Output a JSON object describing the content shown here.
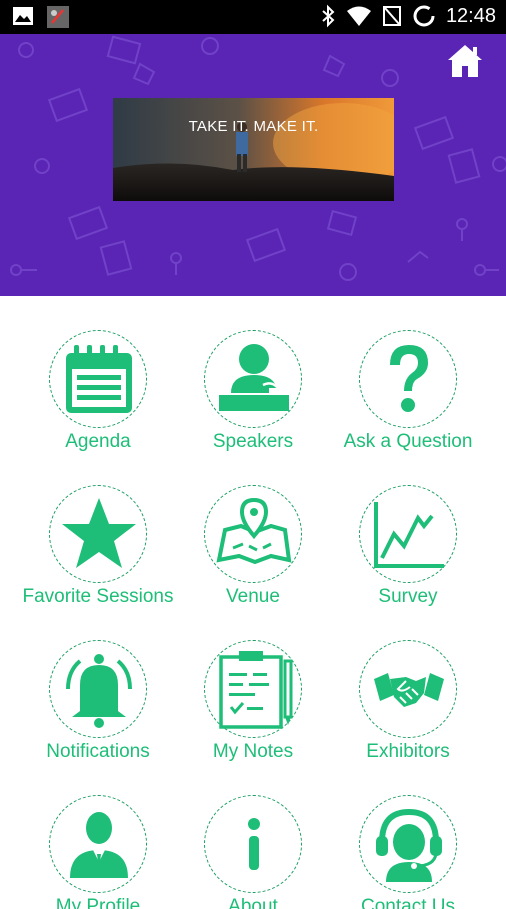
{
  "status_bar": {
    "time": "12:48",
    "left_icons": [
      "image-icon",
      "app-notification-icon"
    ],
    "right_icons": [
      "bluetooth-icon",
      "wifi-icon",
      "no-signal-icon",
      "loading-ring-icon"
    ]
  },
  "banner": {
    "text": "TAKE IT. MAKE IT."
  },
  "colors": {
    "header": "#5a24b5",
    "accent": "#1ebe78",
    "circle_border": "#1b9e63"
  },
  "menu": {
    "items": [
      {
        "label": "Agenda",
        "icon": "calendar-icon"
      },
      {
        "label": "Speakers",
        "icon": "speaker-icon"
      },
      {
        "label": "Ask a Question",
        "icon": "question-icon"
      },
      {
        "label": "Favorite Sessions",
        "icon": "star-icon"
      },
      {
        "label": "Venue",
        "icon": "map-pin-icon"
      },
      {
        "label": "Survey",
        "icon": "line-chart-icon"
      },
      {
        "label": "Notifications",
        "icon": "bell-icon"
      },
      {
        "label": "My Notes",
        "icon": "clipboard-icon"
      },
      {
        "label": "Exhibitors",
        "icon": "handshake-icon"
      },
      {
        "label": "My Profile",
        "icon": "user-icon"
      },
      {
        "label": "About",
        "icon": "info-icon"
      },
      {
        "label": "Contact Us",
        "icon": "headset-icon"
      }
    ]
  }
}
